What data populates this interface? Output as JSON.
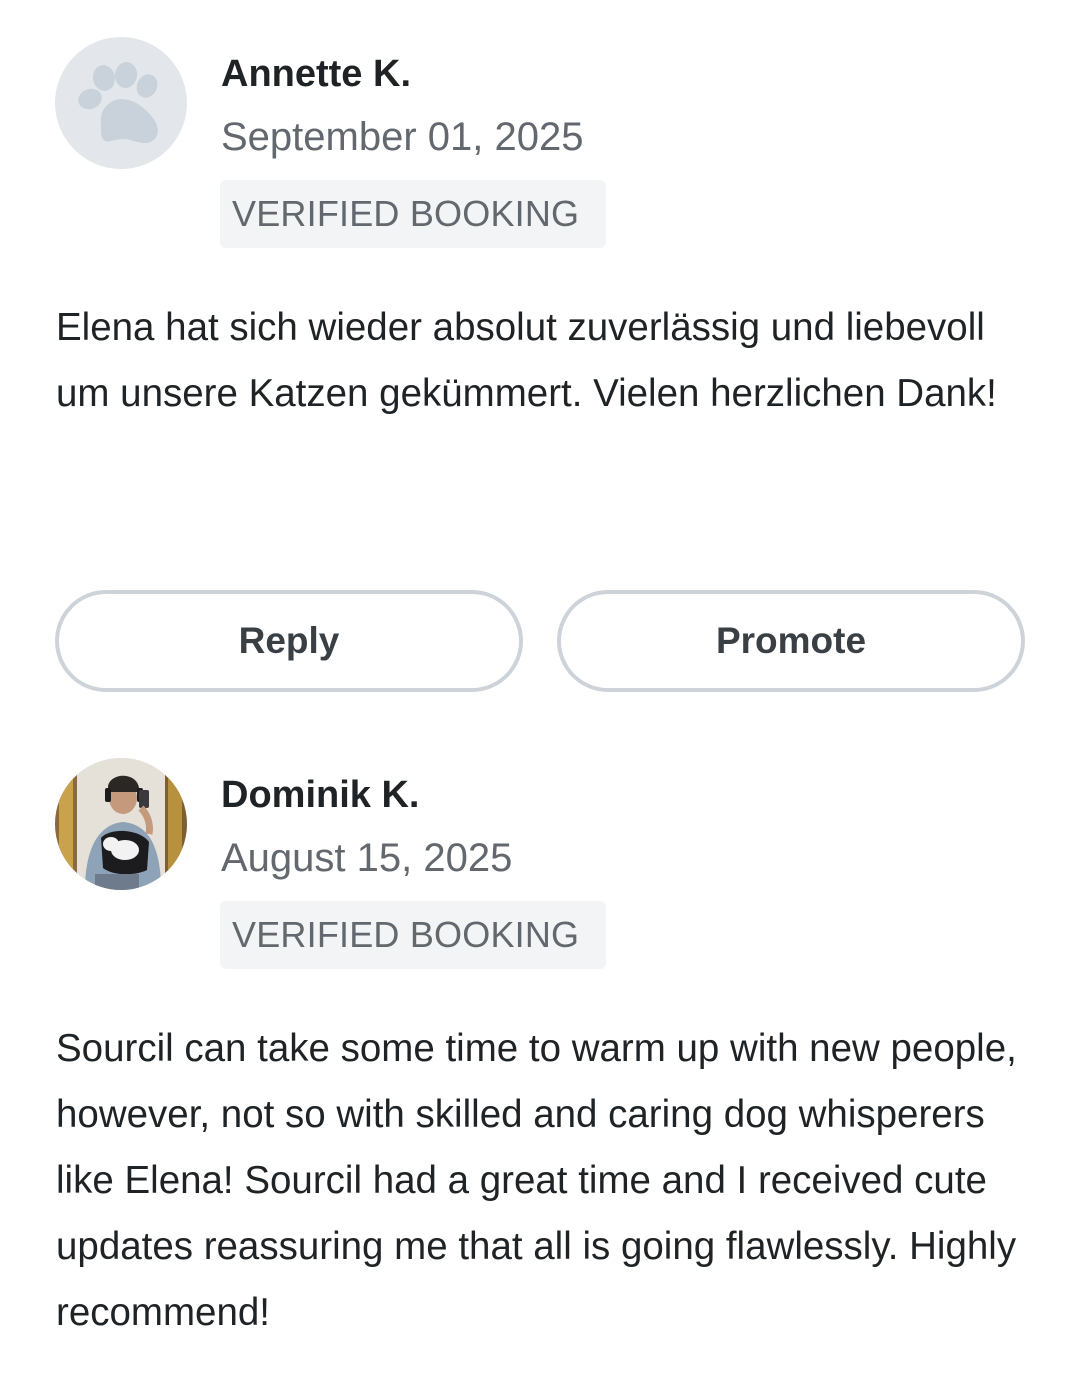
{
  "reviews": [
    {
      "reviewer_name": "Annette K.",
      "date": "September 01, 2025",
      "badge": "VERIFIED BOOKING",
      "avatar_icon": "paw-icon",
      "text": "Elena hat sich wieder absolut zuverlässig und liebevoll um unsere Katzen gekümmert. Vielen herzlichen Dank!"
    },
    {
      "reviewer_name": "Dominik K.",
      "date": "August 15, 2025",
      "badge": "VERIFIED BOOKING",
      "avatar_icon": "user-photo",
      "text": "Sourcil can take some time to warm up with new people, however, not so with skilled and caring dog whisperers like Elena! Sourcil had a great time and I received cute updates reassuring me that all is going flawlessly. Highly recommend!"
    }
  ],
  "actions": {
    "reply_label": "Reply",
    "promote_label": "Promote"
  },
  "colors": {
    "text_primary": "#1f2326",
    "text_secondary": "#62686e",
    "badge_background": "#f2f4f6",
    "button_border": "#cdd3d9",
    "avatar_placeholder": "#e3e7eb",
    "paw_color": "#c9d2da"
  }
}
